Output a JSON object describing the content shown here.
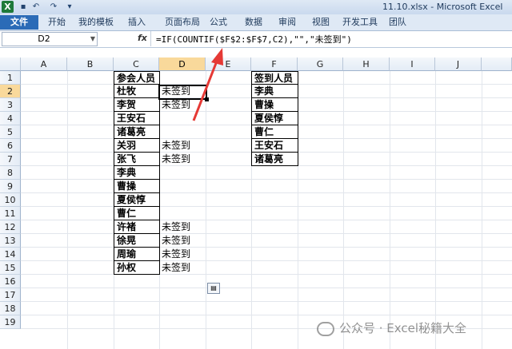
{
  "window": {
    "title": "11.10.xlsx - Microsoft Excel",
    "app_icon": "X"
  },
  "quick_access": {
    "icons": [
      "save-icon",
      "undo-icon",
      "redo-icon",
      "customize-icon"
    ]
  },
  "ribbon": {
    "tabs": [
      "文件",
      "开始",
      "我的模板",
      "插入",
      "页面布局",
      "公式",
      "数据",
      "审阅",
      "视图",
      "开发工具",
      "团队"
    ]
  },
  "formula_bar": {
    "name_box": "D2",
    "fx": "fx",
    "formula": "=IF(COUNTIF($F$2:$F$7,C2),\"\",\"未签到\")"
  },
  "columns": [
    "A",
    "B",
    "C",
    "D",
    "E",
    "F",
    "G",
    "H",
    "I",
    "J"
  ],
  "rows": [
    "1",
    "2",
    "3",
    "4",
    "5",
    "6",
    "7",
    "8",
    "9",
    "10",
    "11",
    "12",
    "13",
    "14",
    "15",
    "16",
    "17",
    "18",
    "19"
  ],
  "column_c": [
    "参会人员",
    "杜牧",
    "李贺",
    "王安石",
    "诸葛亮",
    "关羽",
    "张飞",
    "李典",
    "曹操",
    "夏侯惇",
    "曹仁",
    "许褚",
    "徐晃",
    "周瑜",
    "孙权"
  ],
  "column_d": [
    "",
    "未签到",
    "未签到",
    "",
    "",
    "未签到",
    "未签到",
    "",
    "",
    "",
    "",
    "未签到",
    "未签到",
    "未签到",
    "未签到"
  ],
  "column_f": [
    "签到人员",
    "李典",
    "曹操",
    "夏侯惇",
    "曹仁",
    "王安石",
    "诸葛亮"
  ],
  "watermark": {
    "text": "公众号 · Excel秘籍大全"
  },
  "colors": {
    "accent": "#2b6bb7",
    "selected_header": "#f9d99b",
    "arrow": "#e53935"
  }
}
